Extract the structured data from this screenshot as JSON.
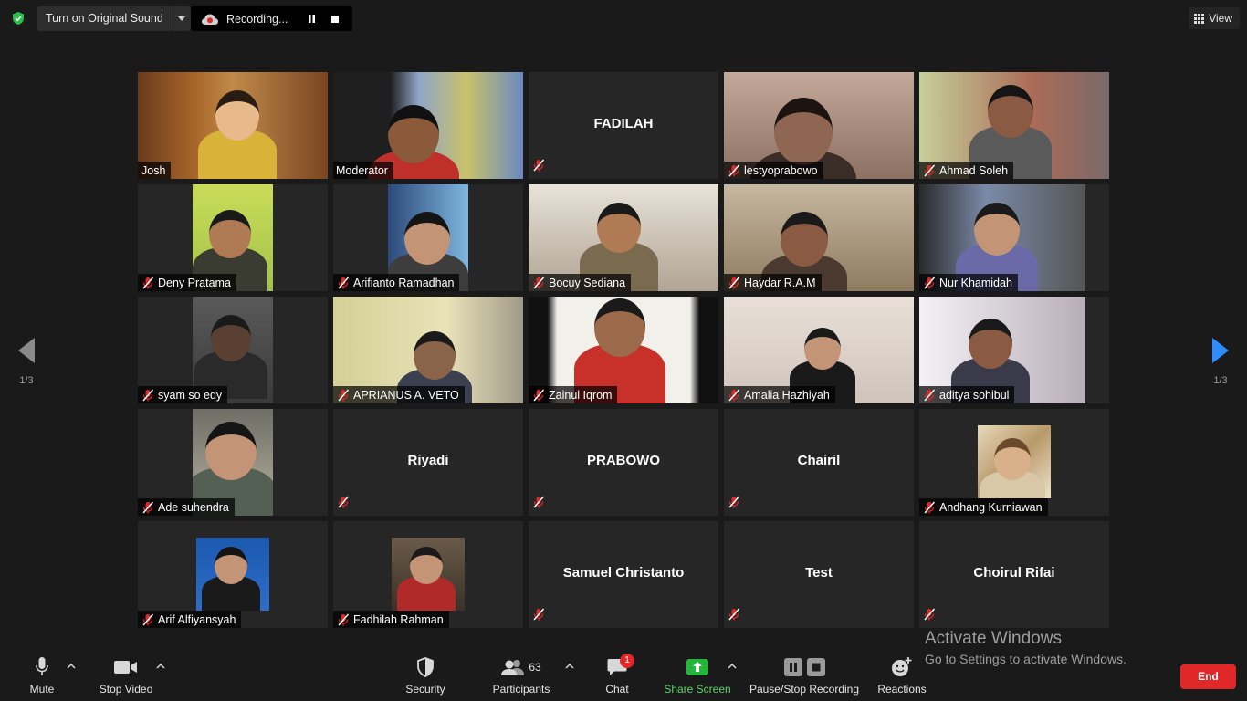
{
  "topbar": {
    "sound_label": "Turn on Original Sound",
    "recording_label": "Recording...",
    "view_label": "View"
  },
  "colors": {
    "active_speaker_border": "#e6f06b",
    "mute_red": "#e02828",
    "share_green": "#25b43c",
    "end_red": "#e02828"
  },
  "participants": [
    {
      "name": "Josh",
      "video": true
    },
    {
      "name": "Moderator",
      "video": true,
      "active": true
    },
    {
      "name": "FADILAH",
      "video": false
    },
    {
      "name": "lestyoprabowo",
      "video": true
    },
    {
      "name": "Ahmad Soleh",
      "video": true
    },
    {
      "name": "Deny Pratama",
      "video": true
    },
    {
      "name": "Arifianto Ramadhan",
      "video": true
    },
    {
      "name": "Bocuy Sediana",
      "video": true
    },
    {
      "name": "Haydar R.A.M",
      "video": true
    },
    {
      "name": "Nur Khamidah",
      "video": true
    },
    {
      "name": "syam so edy",
      "video": true
    },
    {
      "name": "APRIANUS A. VETO",
      "video": true
    },
    {
      "name": "Zainul Iqrom",
      "video": true
    },
    {
      "name": "Amalia Hazhiyah",
      "video": true
    },
    {
      "name": "aditya sohibul",
      "video": true
    },
    {
      "name": "Ade suhendra",
      "video": true
    },
    {
      "name": "Riyadi",
      "video": false
    },
    {
      "name": "PRABOWO",
      "video": false
    },
    {
      "name": "Chairil",
      "video": false
    },
    {
      "name": "Andhang Kurniawan",
      "video": true
    },
    {
      "name": "Arif Alfiyansyah",
      "video": true
    },
    {
      "name": "Fadhilah Rahman",
      "video": true
    },
    {
      "name": "Samuel Christanto",
      "video": false
    },
    {
      "name": "Test",
      "video": false
    },
    {
      "name": "Choirul Rifai",
      "video": false
    }
  ],
  "pagination": {
    "prev": "1/3",
    "next": "1/3"
  },
  "watermark": {
    "title": "Activate Windows",
    "subtitle": "Go to Settings to activate Windows."
  },
  "toolbar": {
    "mute": "Mute",
    "stop_video": "Stop Video",
    "security": "Security",
    "participants": "Participants",
    "participant_count": "63",
    "chat": "Chat",
    "chat_badge": "1",
    "share_screen": "Share Screen",
    "pause_stop_recording": "Pause/Stop Recording",
    "reactions": "Reactions",
    "end": "End"
  }
}
